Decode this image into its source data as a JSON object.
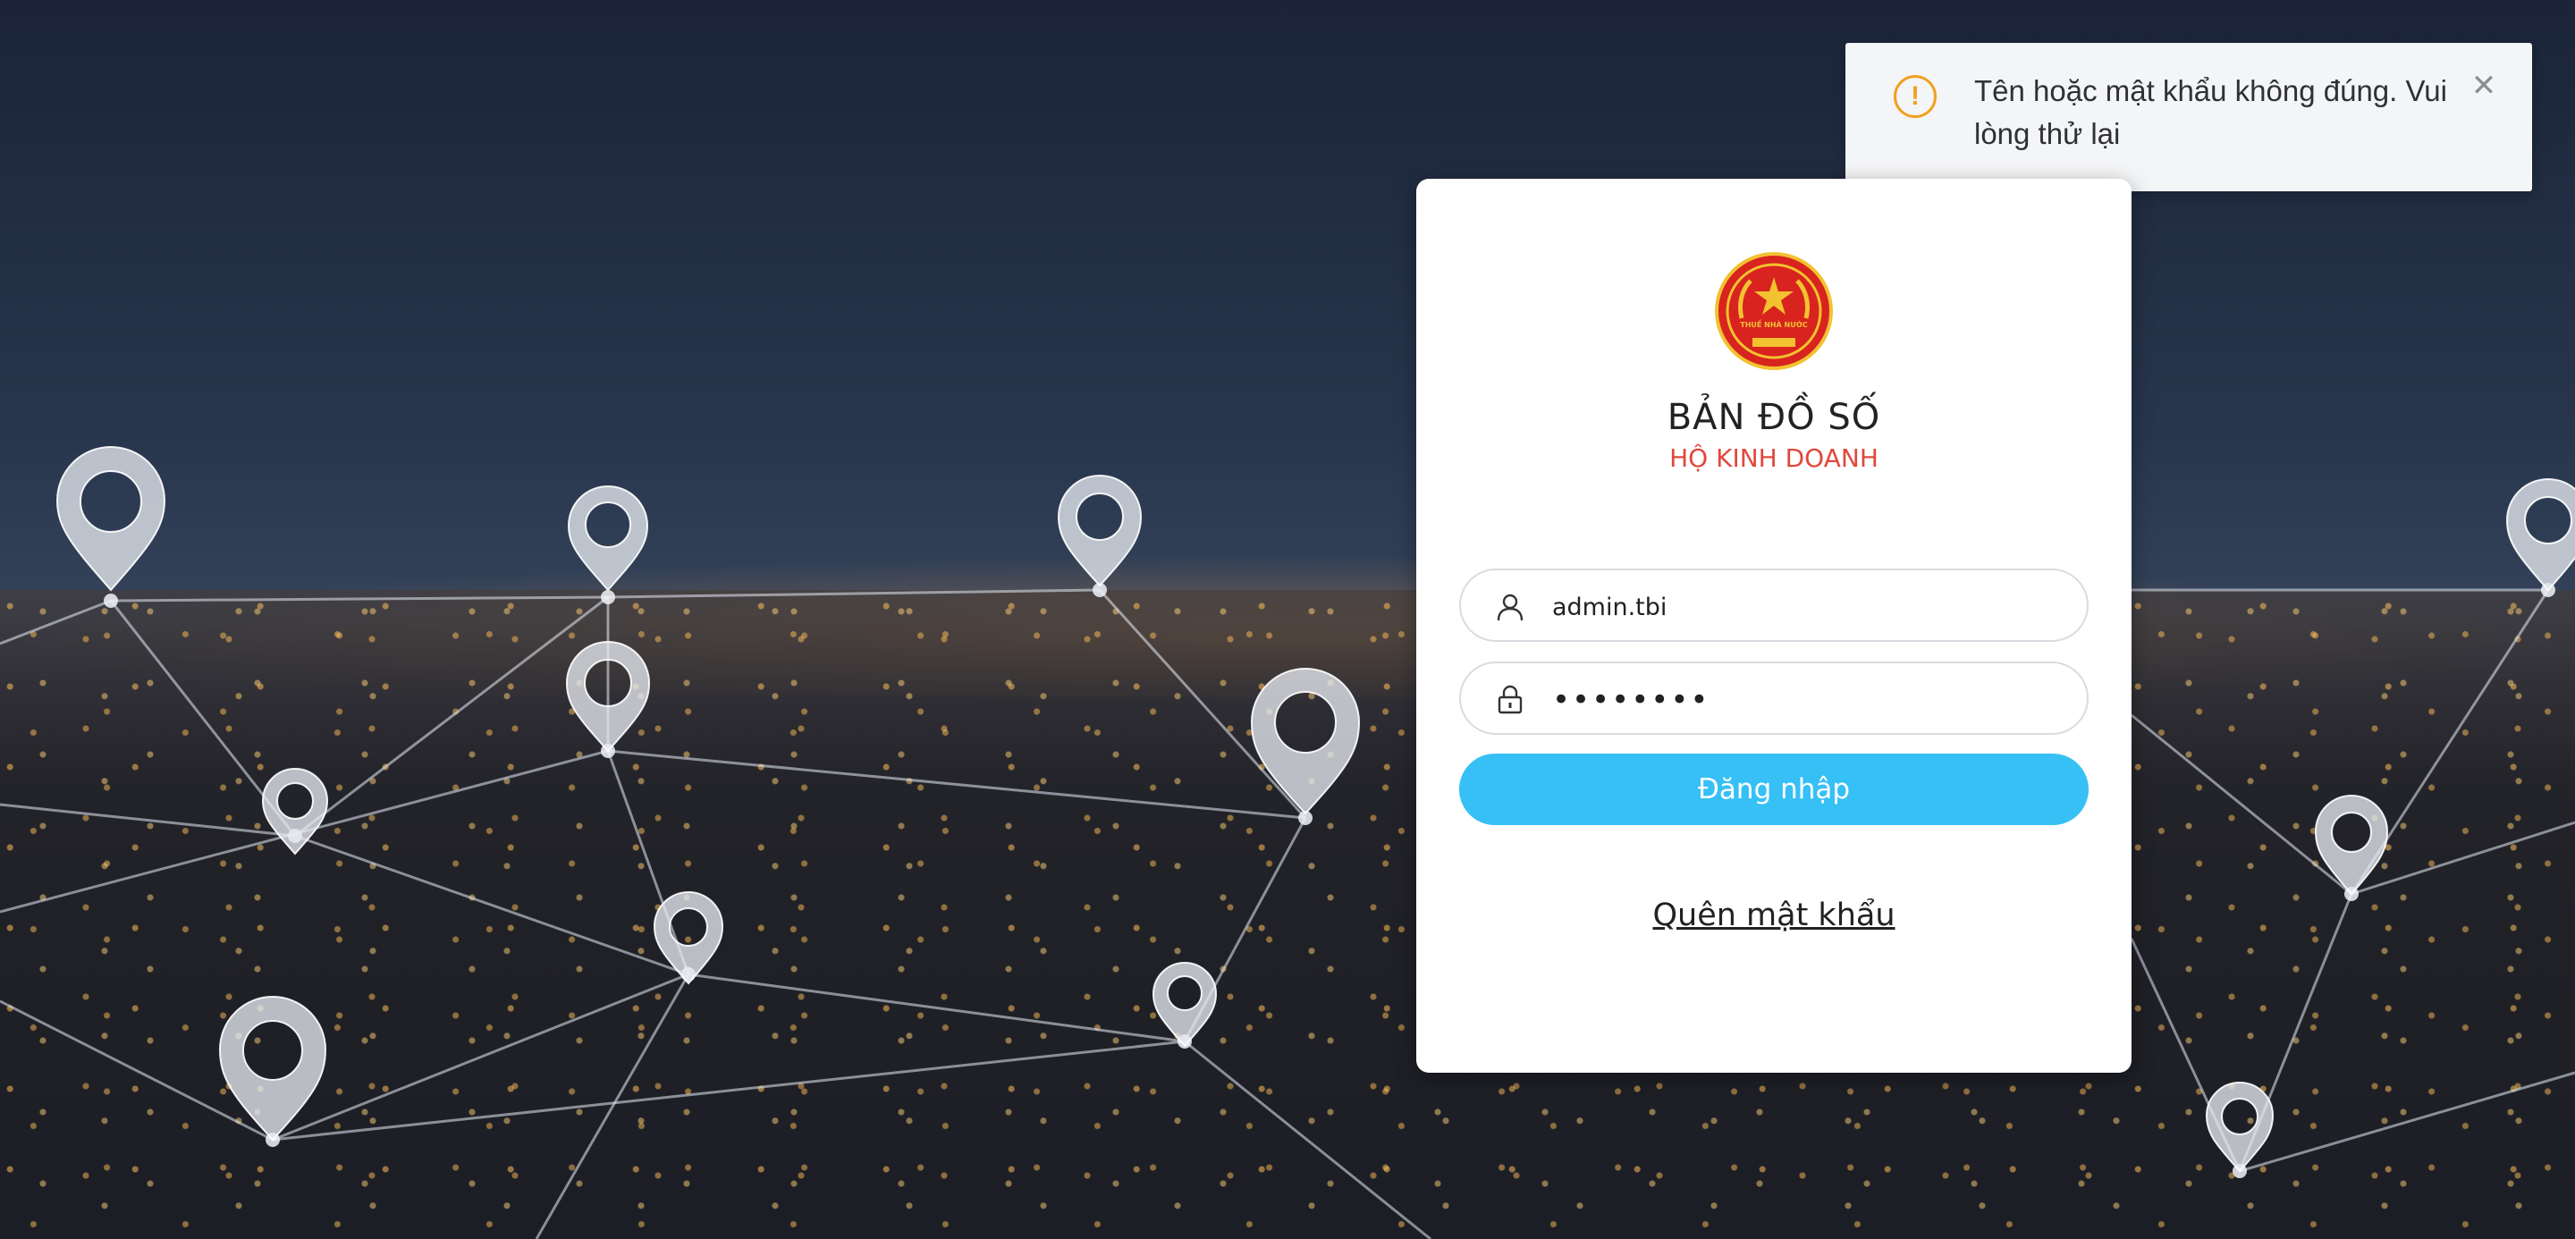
{
  "toast": {
    "message": "Tên hoặc mật khẩu không đúng. Vui lòng thử lại",
    "icon": "warning-icon",
    "icon_glyph": "!",
    "close_glyph": "✕",
    "accent": "#f0a020"
  },
  "login": {
    "logo_text": "THUẾ NHÀ NƯỚC",
    "title": "BẢN ĐỒ SỐ",
    "subtitle": "HỘ KINH DOANH",
    "username_value": "admin.tbi",
    "password_value": "••••••••",
    "submit_label": "Đăng nhập",
    "forgot_label": "Quên mật khẩu",
    "button_color": "#36c0f6",
    "subtitle_color": "#e0483c"
  }
}
